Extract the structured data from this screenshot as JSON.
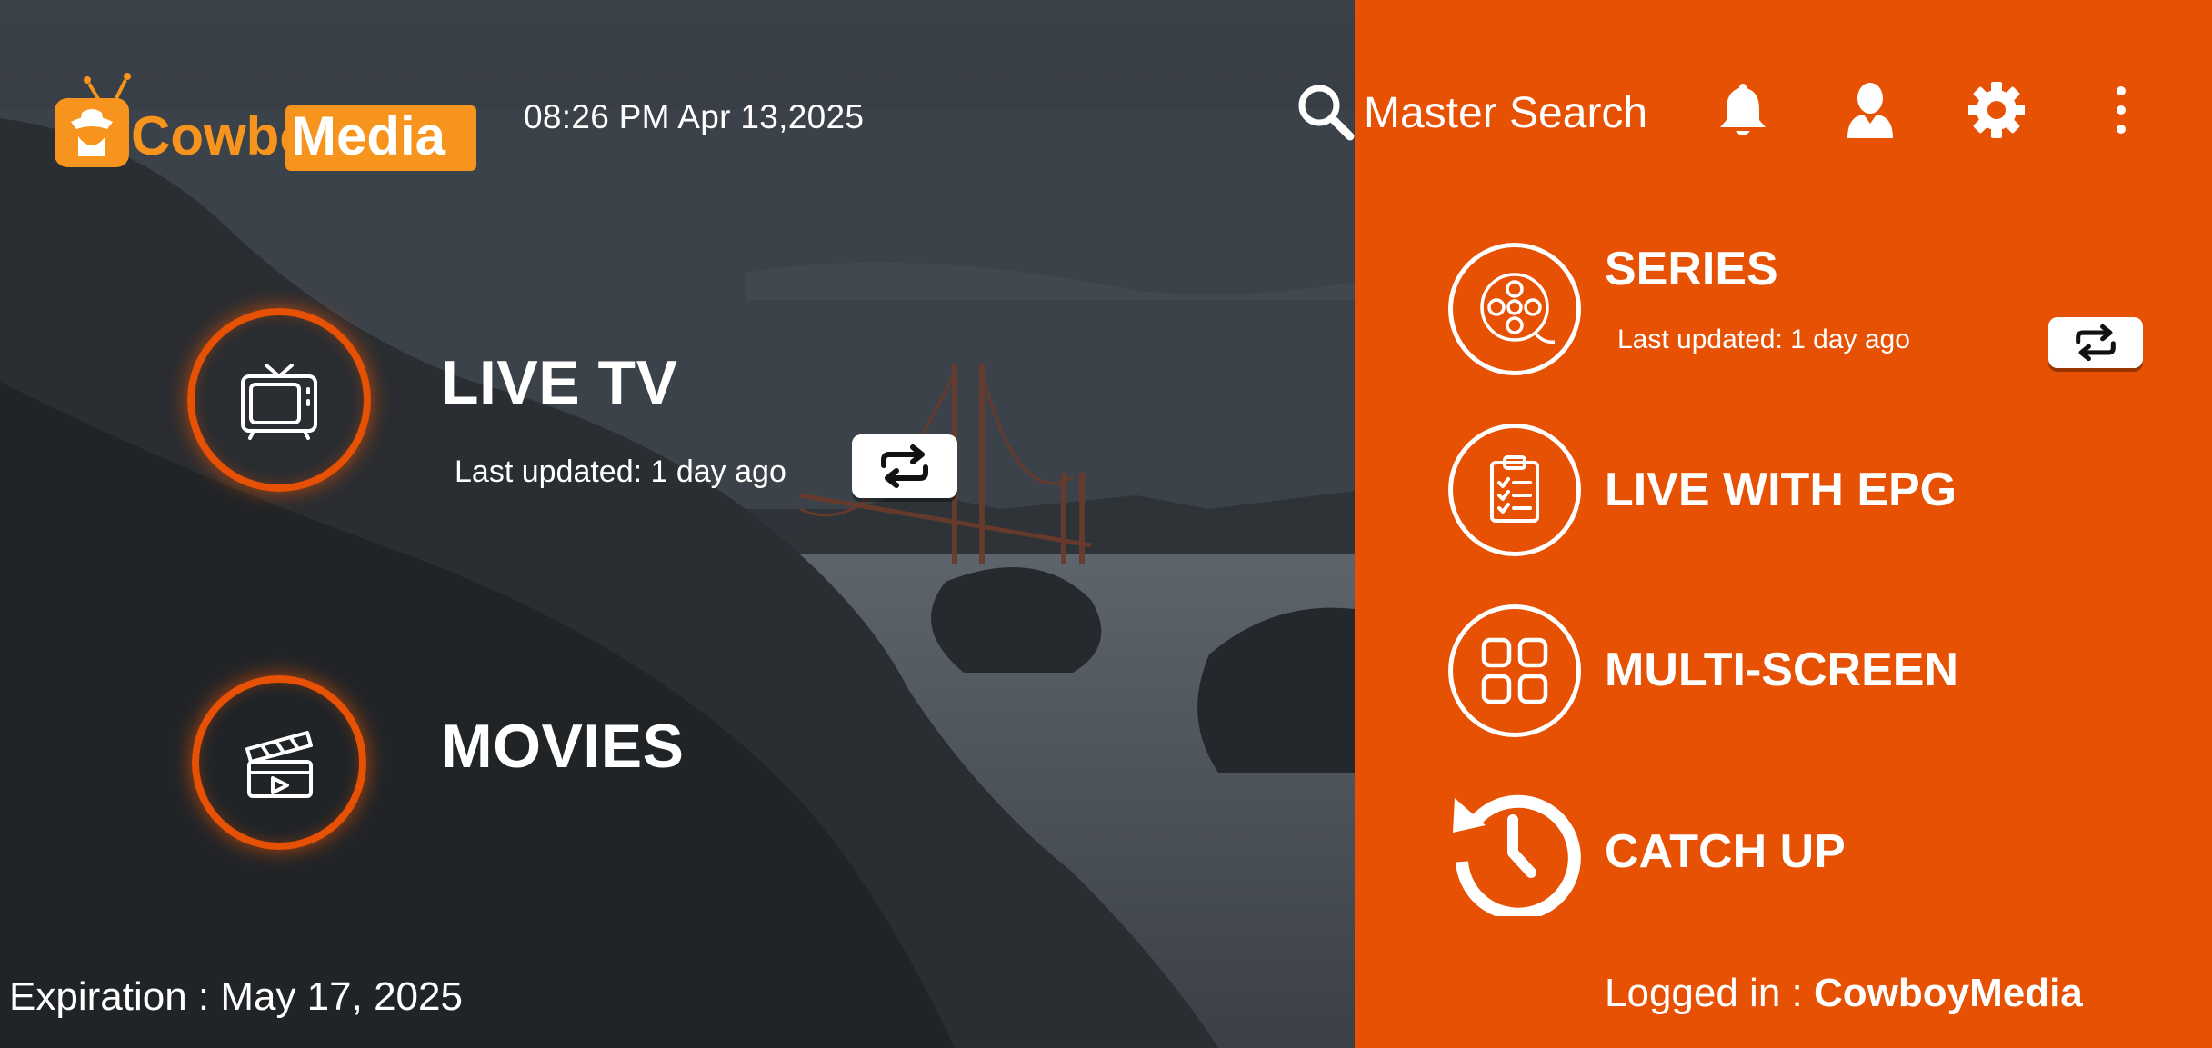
{
  "header": {
    "logo_text_part1": "Cowboy",
    "logo_text_part2": "Media",
    "datetime": "08:26 PM  Apr 13,2025",
    "search_label": "Master Search"
  },
  "tiles": {
    "live_tv": {
      "title": "LIVE TV",
      "updated": "Last updated: 1 day ago"
    },
    "movies": {
      "title": "MOVIES"
    }
  },
  "menu": {
    "series": {
      "title": "SERIES",
      "updated": "Last updated: 1 day ago"
    },
    "live_epg": {
      "title": "LIVE WITH EPG"
    },
    "multi_screen": {
      "title": "MULTI-SCREEN"
    },
    "catch_up": {
      "title": "CATCH UP"
    }
  },
  "footer": {
    "expiration": "Expiration : May 17, 2025",
    "logged_in_label": "Logged in : ",
    "logged_in_user": "CowboyMedia"
  },
  "colors": {
    "accent": "#e65104",
    "logo_orange": "#f7941d"
  },
  "icons": [
    "tv-icon",
    "clapperboard-icon",
    "film-reel-icon",
    "clipboard-check-icon",
    "grid-icon",
    "history-icon",
    "search-icon",
    "bell-icon",
    "user-icon",
    "gear-icon",
    "more-vertical-icon",
    "refresh-icon"
  ]
}
